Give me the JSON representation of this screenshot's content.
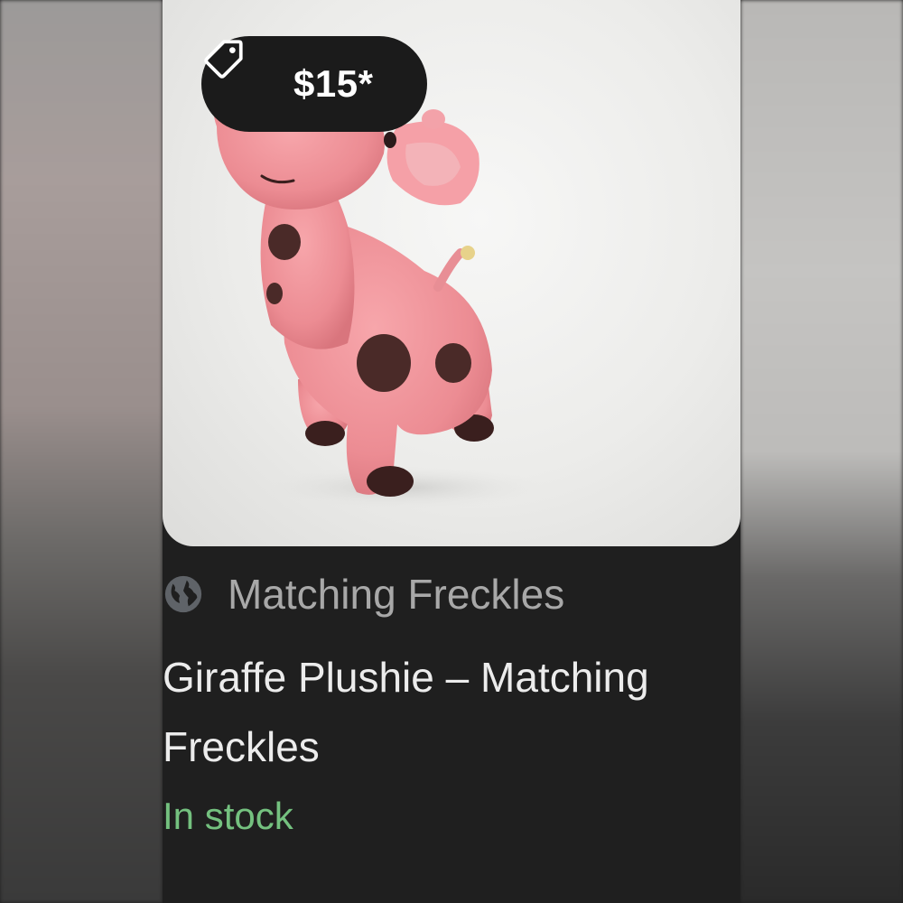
{
  "product": {
    "price": "$15*",
    "source": "Matching Freckles",
    "title": "Giraffe Plushie – Matching Freckles",
    "availability": "In stock"
  },
  "icons": {
    "price_tag": "tag-icon",
    "source": "globe-icon"
  },
  "colors": {
    "card_background": "#1f1f1f",
    "price_pill": "#1b1b1b",
    "stock_green": "#74c17f",
    "source_gray": "#a8a8a8",
    "title_text": "#ececec"
  }
}
